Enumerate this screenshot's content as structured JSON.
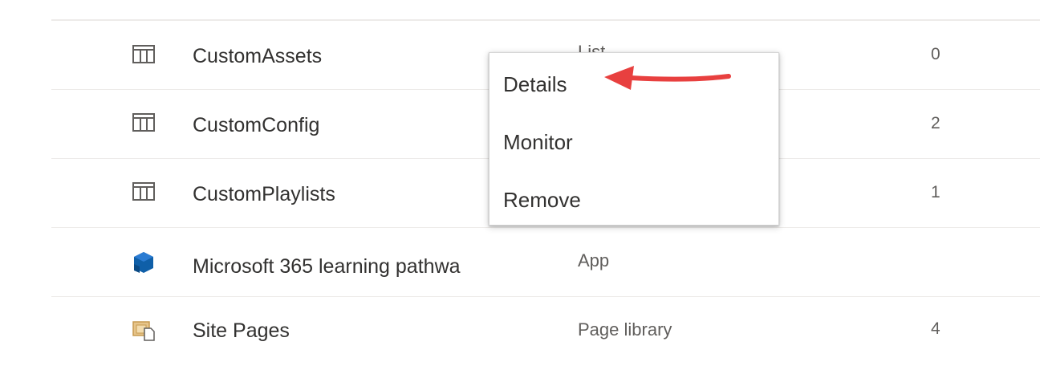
{
  "rows": [
    {
      "name": "CustomAssets",
      "type": "List",
      "count": "0",
      "icon": "list-icon"
    },
    {
      "name": "CustomConfig",
      "type": "",
      "count": "2",
      "icon": "list-icon"
    },
    {
      "name": "CustomPlaylists",
      "type": "",
      "count": "1",
      "icon": "list-icon"
    },
    {
      "name": "Microsoft 365 learning pathwa",
      "type": "App",
      "count": "",
      "icon": "app-icon"
    },
    {
      "name": "Site Pages",
      "type": "Page library",
      "count": "4",
      "icon": "page-library-icon"
    }
  ],
  "context_menu": {
    "items": [
      {
        "label": "Details"
      },
      {
        "label": "Monitor"
      },
      {
        "label": "Remove"
      }
    ]
  },
  "colors": {
    "annotation_arrow": "#e8403f",
    "app_icon": "#0f5fa8",
    "page_library_icon": "#d8b06a"
  }
}
